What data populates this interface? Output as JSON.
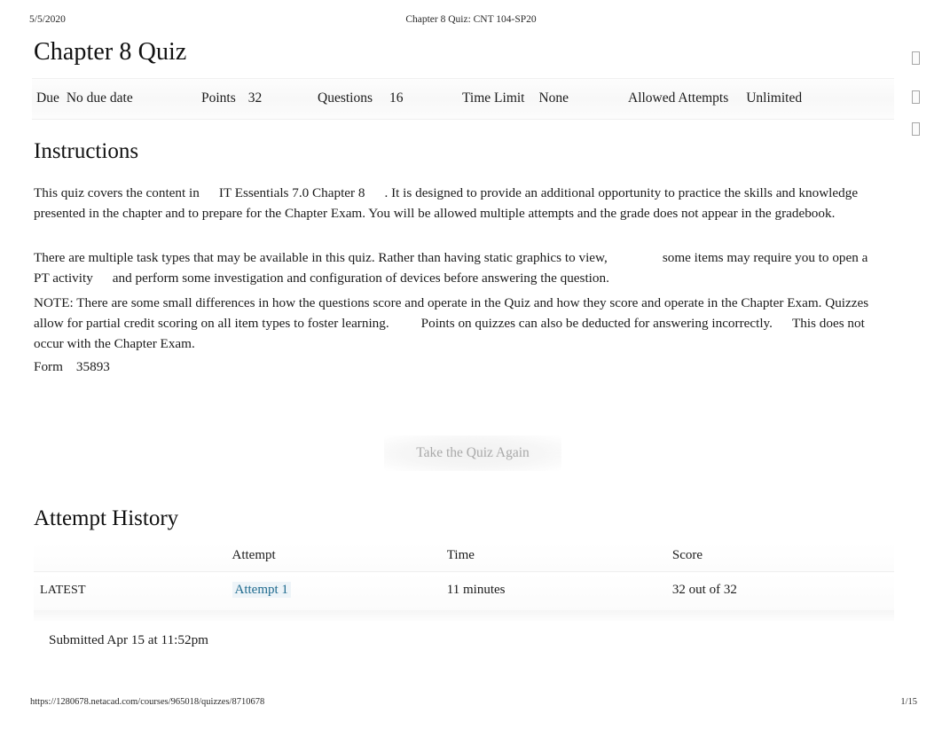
{
  "print_header": {
    "date": "5/5/2020",
    "document_title": "Chapter 8 Quiz: CNT 104-SP20"
  },
  "page_title": "Chapter 8 Quiz",
  "side_icons": [
    {
      "name": "missing-glyph-icon-1",
      "glyph": ""
    },
    {
      "name": "missing-glyph-icon-2",
      "glyph": ""
    },
    {
      "name": "missing-glyph-icon-3",
      "glyph": ""
    }
  ],
  "meta_bar": [
    {
      "label": "Due",
      "value": "No due date"
    },
    {
      "label": "Points",
      "value": "32"
    },
    {
      "label": "Questions",
      "value": "16"
    },
    {
      "label": "Time Limit",
      "value": "None"
    },
    {
      "label": "Allowed Attempts",
      "value": "Unlimited"
    }
  ],
  "instructions": {
    "heading": "Instructions",
    "para1_before": "This quiz covers the content in",
    "para1_emphasis": "IT Essentials 7.0 Chapter 8",
    "para1_after": ". It is designed to provide an additional opportunity to practice the skills and knowledge presented in the chapter and to prepare for the Chapter Exam. You will be allowed multiple attempts and the grade does not appear in the gradebook.",
    "para2_before": "There are multiple task types that may be available in this quiz. Rather than having static graphics to view,",
    "para2_middle": "some items may require you to open a PT activity",
    "para2_after": "and perform some investigation and configuration of devices before answering the question.",
    "para3_before": "NOTE:  There are some small differences in how the questions score and operate in the Quiz and how they score and operate in the Chapter Exam. Quizzes allow for partial credit scoring on all item types to foster learning.",
    "para3_middle": "Points on quizzes can also be deducted for answering incorrectly.",
    "para3_after": "This does not occur with the Chapter Exam.",
    "form_label": "Form",
    "form_value": "35893"
  },
  "take_quiz_again_button": "Take the Quiz Again",
  "attempt_history": {
    "heading": "Attempt History",
    "columns": [
      "",
      "Attempt",
      "Time",
      "Score"
    ],
    "rows": [
      {
        "kept": "LATEST",
        "attempt": "Attempt 1",
        "time": "11 minutes",
        "score": "32 out of 32"
      }
    ],
    "submitted": "Submitted Apr 15 at 11:52pm"
  },
  "print_footer": {
    "url": "https://1280678.netacad.com/courses/965018/quizzes/8710678",
    "page": "1/15"
  },
  "colors": {
    "link": "#1e6a8e",
    "link_highlight": "#eef4f8",
    "text": "#1b1b1b",
    "muted_button_text": "#a9a9a9"
  }
}
